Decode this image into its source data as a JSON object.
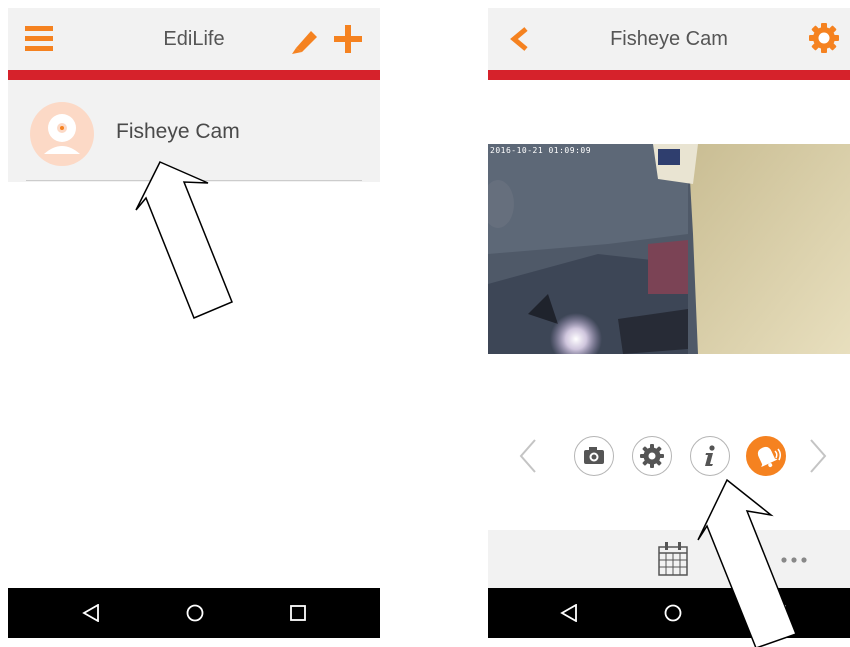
{
  "left_screen": {
    "app_title": "EdiLife",
    "device_name": "Fisheye Cam"
  },
  "right_screen": {
    "title": "Fisheye Cam",
    "video_timestamp": "2016-10-21  01:09:09"
  },
  "colors": {
    "accent": "#f58220",
    "red_bar": "#d6222b",
    "bar_bg": "#f2f2f2",
    "nav_bg": "#000000"
  },
  "icons": {
    "left_header": [
      "menu-icon",
      "pencil-icon",
      "plus-icon"
    ],
    "right_header": [
      "back-chevron-icon",
      "settings-gear-icon"
    ],
    "controls": [
      "snapshot-camera-icon",
      "settings-icon",
      "info-icon",
      "alarm-bell-icon"
    ],
    "bottom_bar": [
      "calendar-icon",
      "more-icon"
    ],
    "navbar": [
      "back-icon",
      "home-icon",
      "recents-icon"
    ]
  }
}
